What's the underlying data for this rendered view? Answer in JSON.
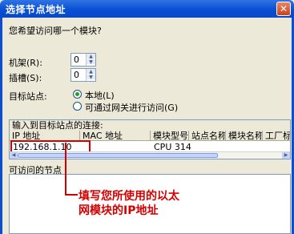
{
  "window": {
    "title": "选择节点地址",
    "close_glyph": "✕"
  },
  "question": "您希望访问哪一个模块?",
  "rack": {
    "label": "机架(R):",
    "value": "0"
  },
  "slot": {
    "label": "插槽(S):",
    "value": "0"
  },
  "target_station": {
    "label": "目标站点:",
    "options": [
      {
        "label": "本地(L)",
        "selected": true
      },
      {
        "label": "可通过网关进行访问(G)",
        "selected": false
      }
    ]
  },
  "connection_table": {
    "caption": "输入到目标站点的连接:",
    "columns": [
      "IP 地址",
      "MAC 地址",
      "模块型号",
      "站点名称",
      "模块名称",
      "工厂标识"
    ],
    "rows": [
      {
        "ip": "192.168.1.10",
        "mac": "",
        "model": "CPU 314",
        "station": "",
        "module": "",
        "plant_id": ""
      }
    ]
  },
  "accessible_nodes": {
    "label": "可访问的节点"
  },
  "annotation": {
    "line1": "填写您所使用的以太",
    "line2": "网模块的IP地址",
    "color": "#d40000"
  }
}
